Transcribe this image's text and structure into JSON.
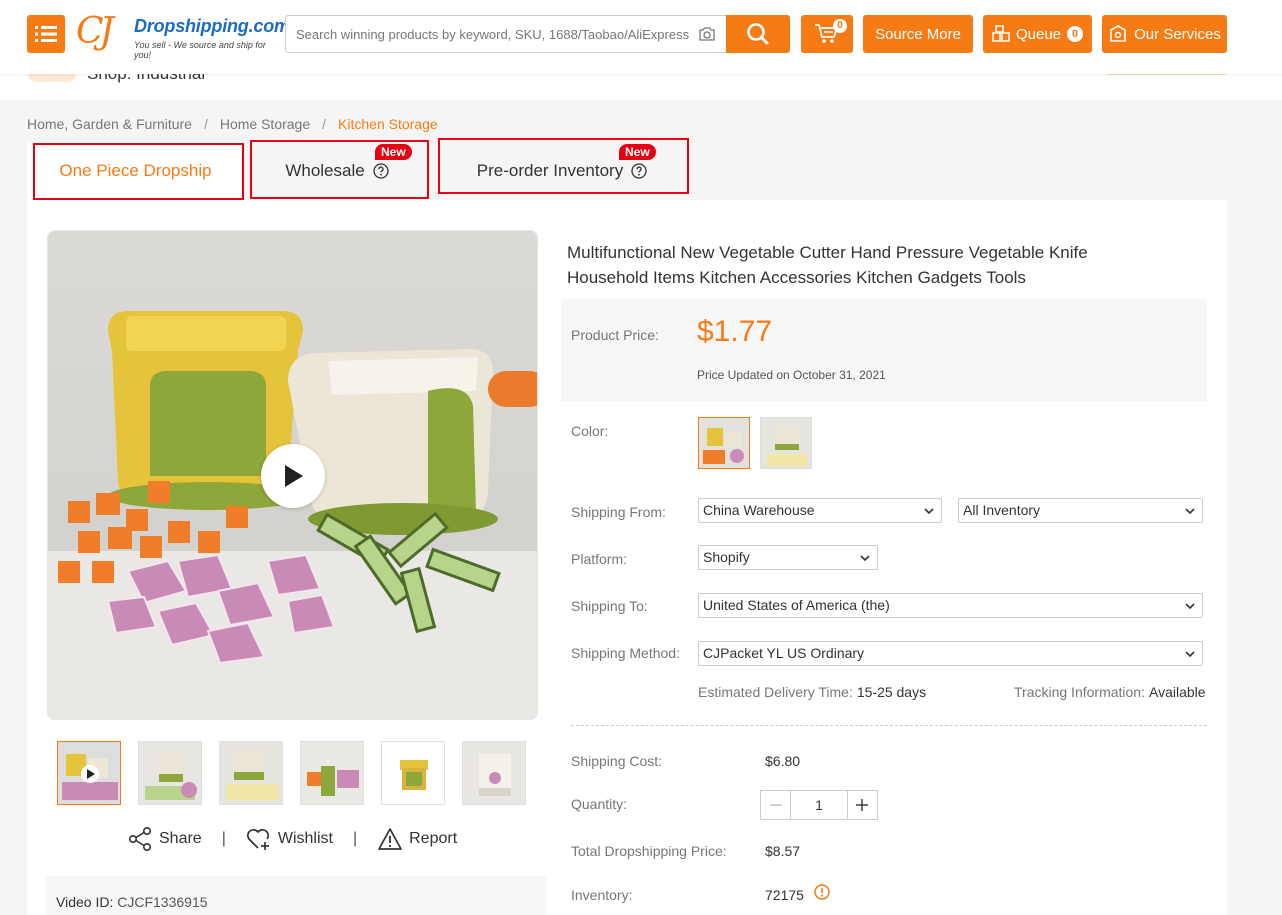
{
  "header": {
    "logo_brand": "Dropshipping.com",
    "logo_tagline": "You sell - We source and ship for you!",
    "search_placeholder": "Search winning products by keyword, SKU, 1688/Taobao/AliExpress URL",
    "cart_count": "0",
    "source_more_label": "Source More",
    "queue_label": "Queue",
    "queue_count": "0",
    "our_services_label": "Our Services",
    "accent_color": "#f77b15"
  },
  "shop": {
    "name": "Shop: Industrial"
  },
  "breadcrumb": [
    "Home, Garden & Furniture",
    "Home Storage",
    "Kitchen Storage"
  ],
  "tabs": [
    {
      "label": "One Piece Dropship",
      "badge": ""
    },
    {
      "label": "Wholesale",
      "badge": "New"
    },
    {
      "label": "Pre-order Inventory",
      "badge": "New"
    }
  ],
  "product": {
    "title": "Multifunctional New Vegetable Cutter Hand Pressure Vegetable Knife Household Items Kitchen Accessories Kitchen Gadgets Tools",
    "price_label": "Product Price:",
    "price": "$1.77",
    "price_updated": "Price Updated on October 31, 2021",
    "color_label": "Color:",
    "shipping_from_label": "Shipping From:",
    "shipping_from": "China Warehouse",
    "inventory_filter": "All Inventory",
    "platform_label": "Platform:",
    "platform": "Shopify",
    "shipping_to_label": "Shipping To:",
    "shipping_to": "United States of America (the)",
    "shipping_method_label": "Shipping Method:",
    "shipping_method": "CJPacket YL US Ordinary",
    "delivery_label": "Estimated Delivery Time:",
    "delivery_value": "15-25 days",
    "tracking_label": "Tracking Information:",
    "tracking_value": "Available",
    "shipping_cost_label": "Shipping Cost:",
    "shipping_cost": "$6.80",
    "quantity_label": "Quantity:",
    "quantity": "1",
    "total_label": "Total Dropshipping Price:",
    "total": "$8.57",
    "inventory_label": "Inventory:",
    "inventory": "72175"
  },
  "media": {
    "share_label": "Share",
    "wishlist_label": "Wishlist",
    "report_label": "Report",
    "video_id_label": "Video ID:",
    "video_id": "CJCF1336915"
  }
}
